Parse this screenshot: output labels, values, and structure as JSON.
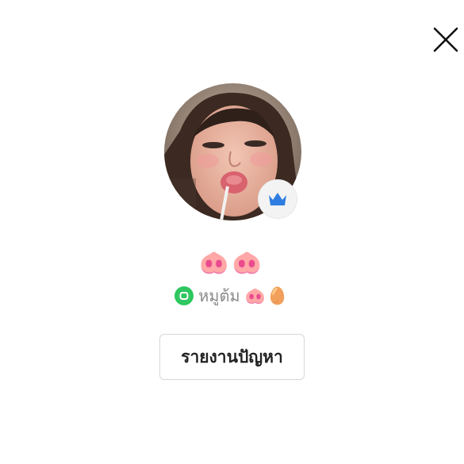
{
  "close": {
    "icon": "close-icon"
  },
  "profile": {
    "avatar_icon": "profile-photo",
    "badge_icon": "crown-icon",
    "badge_color": "#2f7de1",
    "display_name": "🐽🐽",
    "app_icon": "line-app-icon",
    "app_icon_color": "#2ec760",
    "username": "หมูต้ม",
    "username_emoji": "🐽🥚"
  },
  "actions": {
    "report_label": "รายงานปัญหา"
  }
}
